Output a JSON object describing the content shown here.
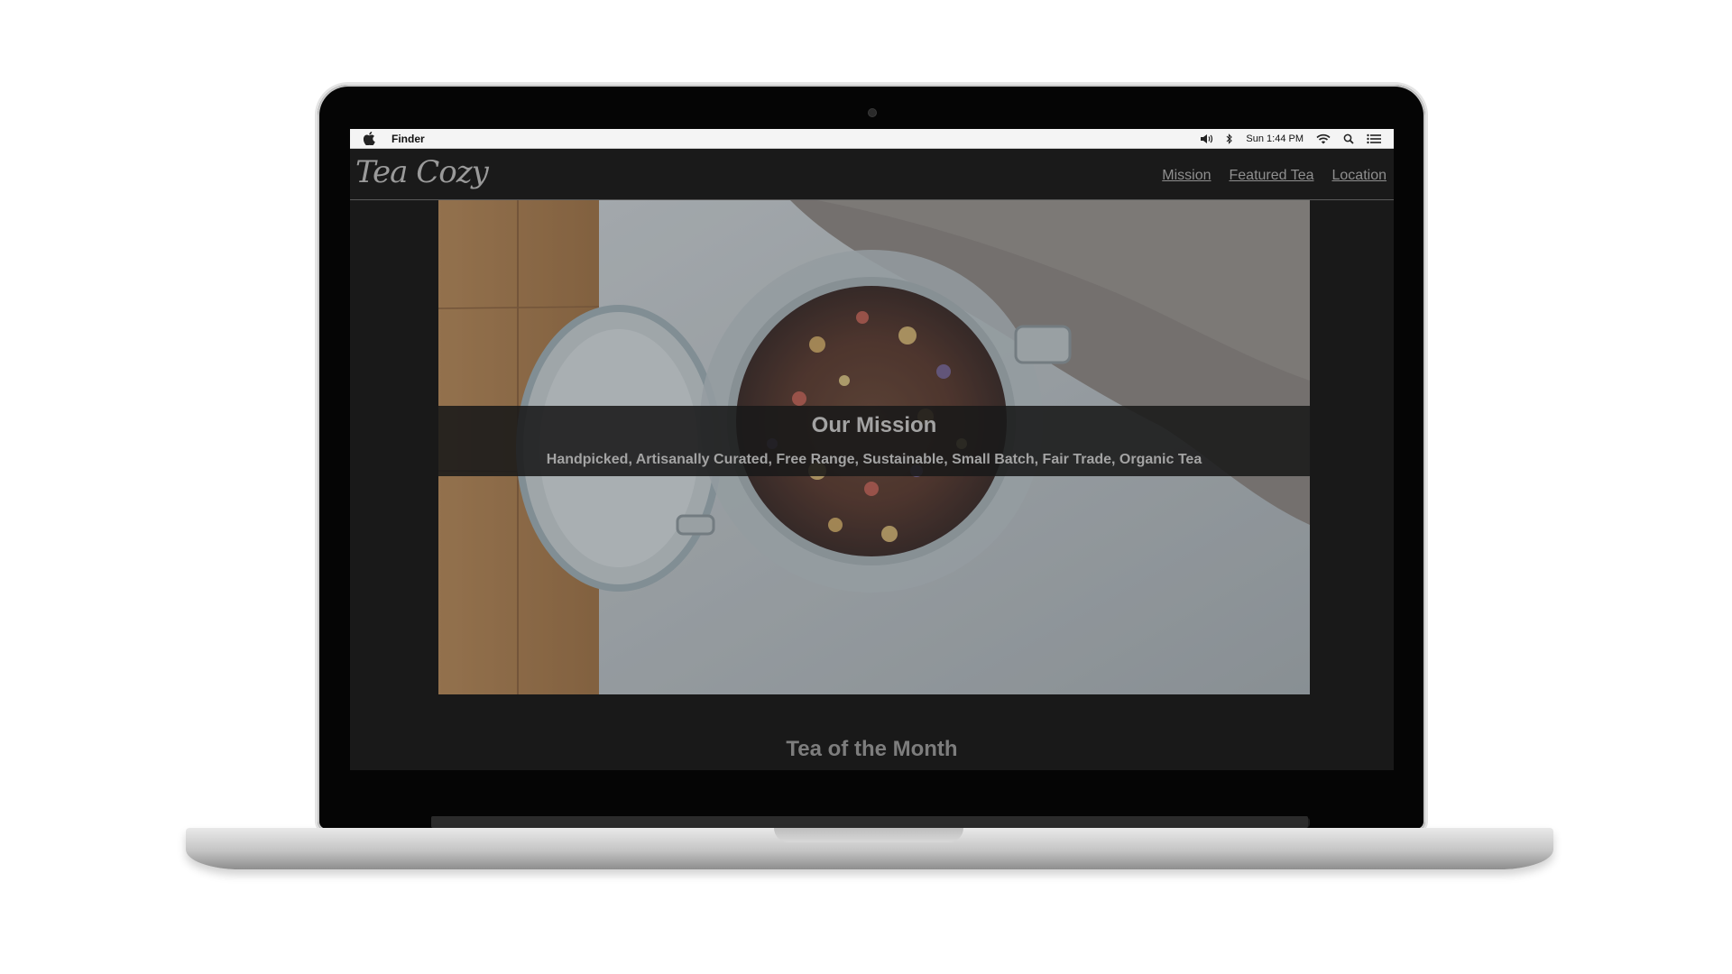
{
  "menubar": {
    "app_name": "Finder",
    "clock": "Sun 1:44 PM",
    "icons": [
      "apple-icon",
      "volume-icon",
      "bluetooth-icon",
      "wifi-icon",
      "spotlight-search-icon",
      "notification-center-icon"
    ]
  },
  "site": {
    "logo": "Tea Cozy",
    "nav": [
      {
        "label": "Mission"
      },
      {
        "label": "Featured Tea"
      },
      {
        "label": "Location"
      }
    ]
  },
  "hero": {
    "title": "Our Mission",
    "subtitle": "Handpicked, Artisanally Curated, Free Range, Sustainable, Small Batch, Fair Trade, Organic Tea"
  },
  "section": {
    "heading": "Tea of the Month"
  },
  "colors": {
    "page_bg": "#191919",
    "text_muted": "#a3a3a3",
    "menubar_bg": "#f4f4f4"
  }
}
